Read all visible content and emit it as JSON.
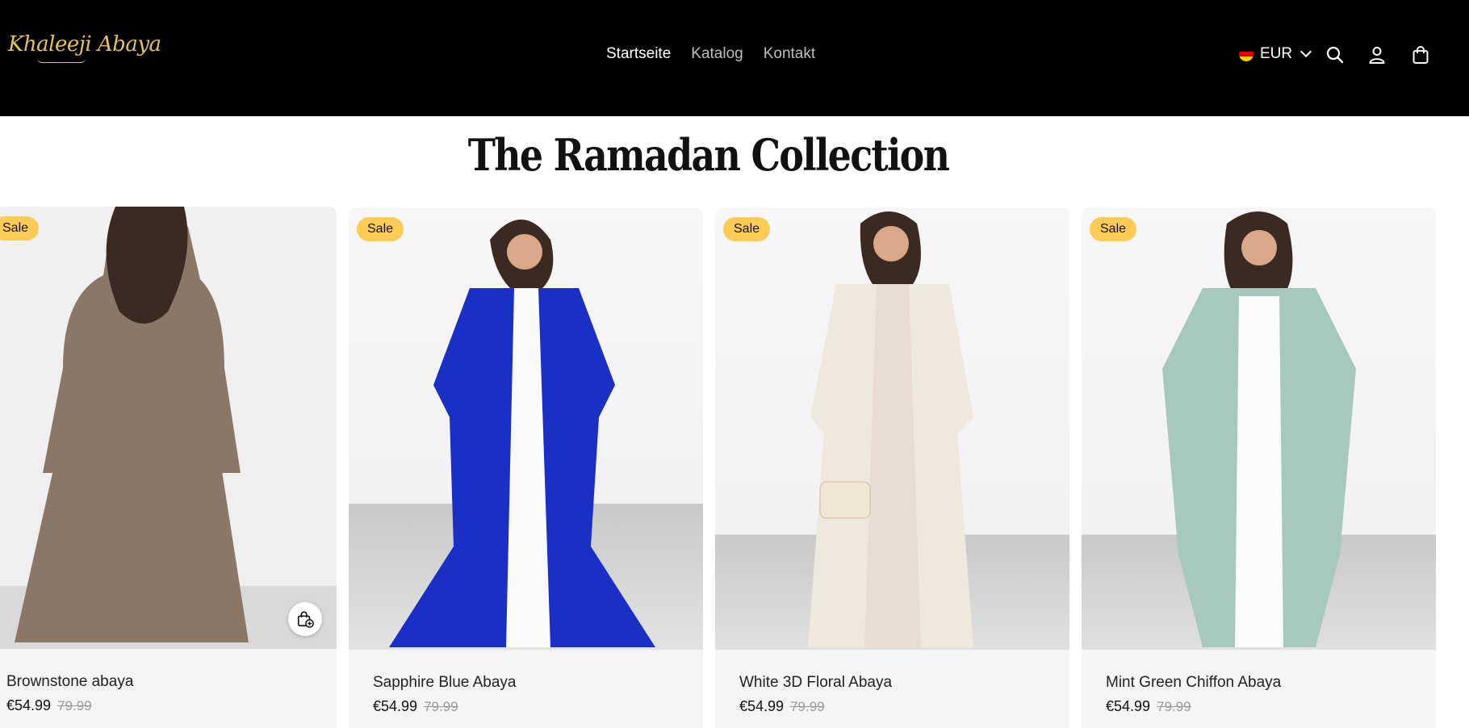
{
  "header": {
    "logo_text": "Khaleeji Abaya",
    "nav": [
      {
        "label": "Startseite",
        "active": true
      },
      {
        "label": "Katalog",
        "active": false
      },
      {
        "label": "Kontakt",
        "active": false
      }
    ],
    "currency": {
      "label": "EUR",
      "flag": "germany-flag",
      "flag_colors": [
        "#000000",
        "#dd0000",
        "#ffce00"
      ]
    },
    "icons": [
      "search-icon",
      "account-icon",
      "cart-icon"
    ]
  },
  "section": {
    "title": "The Ramadan Collection"
  },
  "products": [
    {
      "name": "Brownstone abaya",
      "price": "€54.99",
      "compare_price": "79.99",
      "badge": "Sale",
      "dress_color": "#8a7767",
      "quick_add_icon": "bag-plus-icon"
    },
    {
      "name": "Sapphire Blue Abaya",
      "price": "€54.99",
      "compare_price": "79.99",
      "badge": "Sale",
      "dress_color": "#1a2fc4"
    },
    {
      "name": "White 3D Floral Abaya",
      "price": "€54.99",
      "compare_price": "79.99",
      "badge": "Sale",
      "dress_color": "#efe8dc"
    },
    {
      "name": "Mint Green Chiffon Abaya",
      "price": "€54.99",
      "compare_price": "79.99",
      "badge": "Sale",
      "dress_color": "#a7c9bb"
    }
  ],
  "colors": {
    "header_bg": "#000000",
    "logo": "#e2c25a",
    "badge_bg": "#ffcb57",
    "card_bg": "#f5f5f5"
  }
}
